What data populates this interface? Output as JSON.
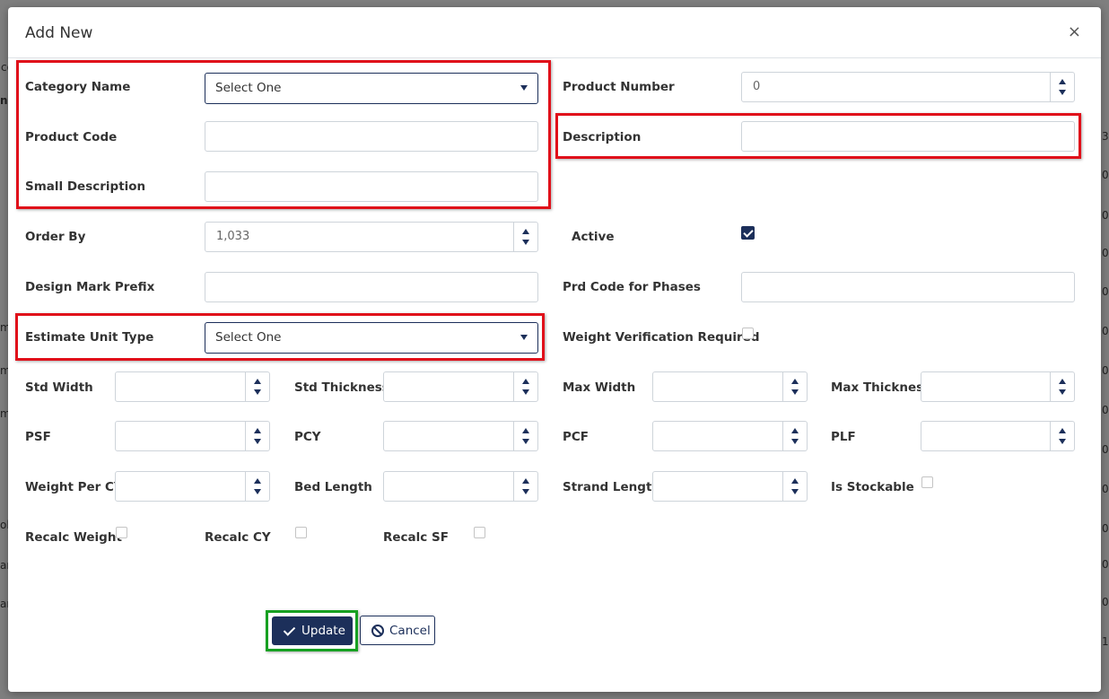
{
  "modal": {
    "title": "Add New",
    "close_glyph": "×"
  },
  "background": {
    "left_fragments": [
      "co",
      "ne",
      "m",
      "m",
      "m",
      "olu",
      "an",
      "an"
    ],
    "right_fragments": [
      "3",
      "0",
      "0",
      "0",
      "0",
      "0",
      "0",
      "0",
      "0",
      "0",
      "0",
      "0",
      "0",
      "1"
    ]
  },
  "fields": {
    "category_name": {
      "label": "Category Name",
      "value": "Select One"
    },
    "product_code": {
      "label": "Product Code",
      "value": ""
    },
    "small_description": {
      "label": "Small Description",
      "value": ""
    },
    "order_by": {
      "label": "Order By",
      "value": "1,033"
    },
    "design_mark_prefix": {
      "label": "Design Mark Prefix",
      "value": ""
    },
    "estimate_unit_type": {
      "label": "Estimate Unit Type",
      "value": "Select One"
    },
    "product_number": {
      "label": "Product Number",
      "value": "0"
    },
    "description": {
      "label": "Description",
      "value": ""
    },
    "active": {
      "label": "Active",
      "checked": true
    },
    "prd_code_for_phases": {
      "label": "Prd Code for Phases",
      "value": ""
    },
    "weight_verification_required": {
      "label": "Weight Verification Required",
      "checked": false
    },
    "std_width": {
      "label": "Std Width",
      "value": ""
    },
    "std_thickness": {
      "label": "Std Thickness",
      "value": ""
    },
    "max_width": {
      "label": "Max Width",
      "value": ""
    },
    "max_thickness": {
      "label": "Max Thickness",
      "value": ""
    },
    "psf": {
      "label": "PSF",
      "value": ""
    },
    "pcy": {
      "label": "PCY",
      "value": ""
    },
    "pcf": {
      "label": "PCF",
      "value": ""
    },
    "plf": {
      "label": "PLF",
      "value": ""
    },
    "weight_per_cy": {
      "label": "Weight Per CY",
      "value": ""
    },
    "bed_length": {
      "label": "Bed Length",
      "value": ""
    },
    "strand_length": {
      "label": "Strand Length",
      "value": ""
    },
    "is_stockable": {
      "label": "Is Stockable",
      "checked": false
    },
    "recalc_weight": {
      "label": "Recalc Weight",
      "checked": false
    },
    "recalc_cy": {
      "label": "Recalc CY",
      "checked": false
    },
    "recalc_sf": {
      "label": "Recalc SF",
      "checked": false
    }
  },
  "buttons": {
    "update": "Update",
    "cancel": "Cancel"
  },
  "colors": {
    "primary": "#1c2f5a",
    "highlight_red": "#e0101a",
    "highlight_green": "#16a021"
  }
}
